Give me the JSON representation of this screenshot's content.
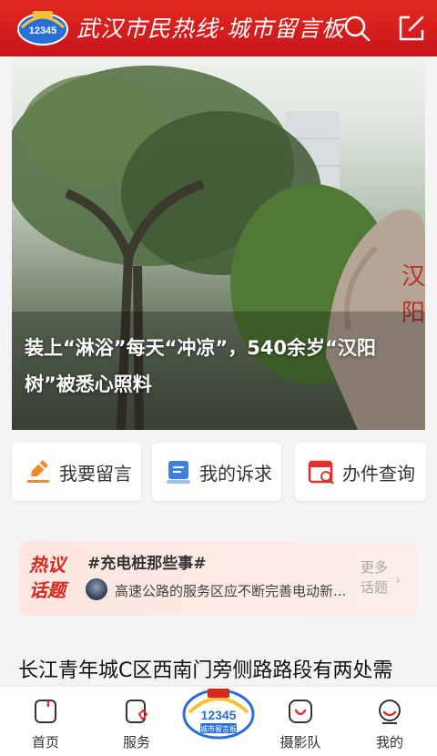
{
  "header": {
    "title": "武汉市民热线·城市留言板",
    "search_icon": "search-icon",
    "share_icon": "external-link-icon",
    "logo_number": "12345"
  },
  "hero": {
    "caption": "装上“淋浴”每天“冲凉”，540余岁“汉阳树”被悉心照料",
    "slide_count": 10,
    "active_slide": 2
  },
  "actions": [
    {
      "label": "我要留言",
      "icon": "pencil-icon"
    },
    {
      "label": "我的诉求",
      "icon": "document-icon"
    },
    {
      "label": "办件查询",
      "icon": "search-document-icon"
    }
  ],
  "hot_topic": {
    "badge_line1": "热议",
    "badge_line2": "话题",
    "topic": "#充电桩那些事#",
    "desc": "高速公路的服务区应不断完善电动新...",
    "more_line1": "更多",
    "more_line2": "话题",
    "arrow": "›"
  },
  "news": {
    "headline": "长江青年城C区西南门旁侧路路段有两处需"
  },
  "tabbar": {
    "home": "首页",
    "service": "服务",
    "photo": "摄影队",
    "mine": "我的",
    "center_number": "12345",
    "center_text": "城市留言板"
  },
  "colors": {
    "brand_red": "#d8281d",
    "header_red": "#e32a20",
    "accent_orange": "#f08a2c",
    "accent_blue": "#3f7fe0"
  }
}
